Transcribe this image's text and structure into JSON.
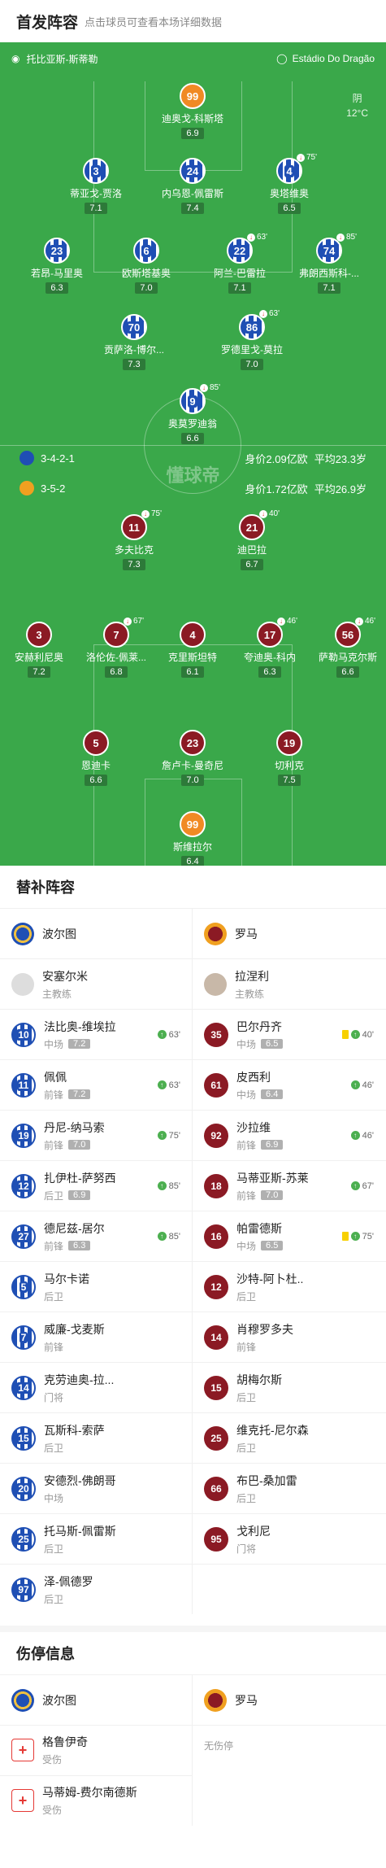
{
  "header": {
    "title": "首发阵容",
    "subtitle": "点击球员可查看本场详细数据"
  },
  "pitch": {
    "referee": "托比亚斯-斯蒂勒",
    "stadium": "Estádio Do Dragão",
    "weather": "阴",
    "temp": "12°C",
    "watermark": "懂球帝",
    "home": {
      "formation": "3-4-2-1",
      "value": "身价2.09亿欧",
      "age": "平均23.3岁"
    },
    "away": {
      "formation": "3-5-2",
      "value": "身价1.72亿欧",
      "age": "平均26.9岁"
    },
    "home_players": [
      {
        "num": "99",
        "name": "迪奥戈-科斯塔",
        "rating": "6.9",
        "gk": true,
        "ev": ""
      },
      {
        "num": "3",
        "name": "蒂亚戈-贾洛",
        "rating": "7.1",
        "ev": ""
      },
      {
        "num": "24",
        "name": "内乌恩-佩雷斯",
        "rating": "7.4",
        "ev": ""
      },
      {
        "num": "4",
        "name": "奥塔维奥",
        "rating": "6.5",
        "ev": "75'"
      },
      {
        "num": "23",
        "name": "若昂-马里奥",
        "rating": "6.3",
        "ev": ""
      },
      {
        "num": "6",
        "name": "欧斯塔基奥",
        "rating": "7.0",
        "ev": ""
      },
      {
        "num": "22",
        "name": "阿兰-巴雷拉",
        "rating": "7.1",
        "ev": "63'"
      },
      {
        "num": "74",
        "name": "弗朗西斯科-...",
        "rating": "7.1",
        "ev": "85'"
      },
      {
        "num": "70",
        "name": "贡萨洛-博尔...",
        "rating": "7.3",
        "ev": ""
      },
      {
        "num": "86",
        "name": "罗德里戈-莫拉",
        "rating": "7.0",
        "ev": "63'"
      },
      {
        "num": "9",
        "name": "奥莫罗迪翁",
        "rating": "6.6",
        "ev": "85'"
      }
    ],
    "away_players": [
      {
        "num": "11",
        "name": "多夫比克",
        "rating": "7.3",
        "ev": "75'"
      },
      {
        "num": "21",
        "name": "迪巴拉",
        "rating": "6.7",
        "ev": "40'"
      },
      {
        "num": "3",
        "name": "安赫利尼奥",
        "rating": "7.2",
        "ev": ""
      },
      {
        "num": "7",
        "name": "洛伦佐-佩莱...",
        "rating": "6.8",
        "ev": "67'"
      },
      {
        "num": "4",
        "name": "克里斯坦特",
        "rating": "6.1",
        "ev": ""
      },
      {
        "num": "17",
        "name": "夸迪奥-科内",
        "rating": "6.3",
        "ev": "46'"
      },
      {
        "num": "56",
        "name": "萨勒马克尔斯",
        "rating": "6.6",
        "ev": "46'"
      },
      {
        "num": "5",
        "name": "恩迪卡",
        "rating": "6.6",
        "ev": ""
      },
      {
        "num": "23",
        "name": "詹卢卡-曼奇尼",
        "rating": "7.0",
        "ev": ""
      },
      {
        "num": "19",
        "name": "切利克",
        "rating": "7.5",
        "ev": ""
      },
      {
        "num": "99",
        "name": "斯维拉尔",
        "rating": "6.4",
        "gk": true,
        "ev": ""
      }
    ]
  },
  "subs": {
    "title": "替补阵容",
    "home_team": "波尔图",
    "away_team": "罗马",
    "home_coach": {
      "name": "安塞尔米",
      "role": "主教练"
    },
    "away_coach": {
      "name": "拉涅利",
      "role": "主教练"
    },
    "rows": [
      [
        {
          "num": "10",
          "name": "法比奥-维埃拉",
          "pos": "中场",
          "rating": "7.2",
          "time": "63'"
        },
        {
          "num": "35",
          "name": "巴尔丹齐",
          "pos": "中场",
          "rating": "6.5",
          "time": "40'",
          "card": true
        }
      ],
      [
        {
          "num": "11",
          "name": "佩佩",
          "pos": "前锋",
          "rating": "7.2",
          "time": "63'"
        },
        {
          "num": "61",
          "name": "皮西利",
          "pos": "中场",
          "rating": "6.4",
          "time": "46'"
        }
      ],
      [
        {
          "num": "19",
          "name": "丹尼-纳马索",
          "pos": "前锋",
          "rating": "7.0",
          "time": "75'"
        },
        {
          "num": "92",
          "name": "沙拉维",
          "pos": "前锋",
          "rating": "6.9",
          "time": "46'"
        }
      ],
      [
        {
          "num": "12",
          "name": "扎伊杜-萨努西",
          "pos": "后卫",
          "rating": "6.9",
          "time": "85'"
        },
        {
          "num": "18",
          "name": "马蒂亚斯-苏莱",
          "pos": "前锋",
          "rating": "7.0",
          "time": "67'"
        }
      ],
      [
        {
          "num": "27",
          "name": "德尼兹-居尔",
          "pos": "前锋",
          "rating": "6.3",
          "time": "85'"
        },
        {
          "num": "16",
          "name": "帕雷德斯",
          "pos": "中场",
          "rating": "6.5",
          "time": "75'",
          "card": true
        }
      ],
      [
        {
          "num": "5",
          "name": "马尔卡诺",
          "pos": "后卫"
        },
        {
          "num": "12",
          "name": "沙特-阿卜杜..",
          "pos": "后卫"
        }
      ],
      [
        {
          "num": "7",
          "name": "威廉-戈麦斯",
          "pos": "前锋"
        },
        {
          "num": "14",
          "name": "肖穆罗多夫",
          "pos": "前锋"
        }
      ],
      [
        {
          "num": "14",
          "name": "克劳迪奥-拉...",
          "pos": "门将"
        },
        {
          "num": "15",
          "name": "胡梅尔斯",
          "pos": "后卫"
        }
      ],
      [
        {
          "num": "15",
          "name": "瓦斯科-索萨",
          "pos": "后卫"
        },
        {
          "num": "25",
          "name": "维克托-尼尔森",
          "pos": "后卫"
        }
      ],
      [
        {
          "num": "20",
          "name": "安德烈-佛朗哥",
          "pos": "中场"
        },
        {
          "num": "66",
          "name": "布巴-桑加雷",
          "pos": "后卫"
        }
      ],
      [
        {
          "num": "25",
          "name": "托马斯-佩雷斯",
          "pos": "后卫"
        },
        {
          "num": "95",
          "name": "戈利尼",
          "pos": "门将"
        }
      ],
      [
        {
          "num": "97",
          "name": "泽-佩德罗",
          "pos": "后卫"
        },
        null
      ]
    ]
  },
  "injuries": {
    "title": "伤停信息",
    "home_team": "波尔图",
    "away_team": "罗马",
    "none": "无伤停",
    "home": [
      {
        "name": "格鲁伊奇",
        "status": "受伤"
      },
      {
        "name": "马蒂姆-费尔南德斯",
        "status": "受伤"
      }
    ]
  }
}
